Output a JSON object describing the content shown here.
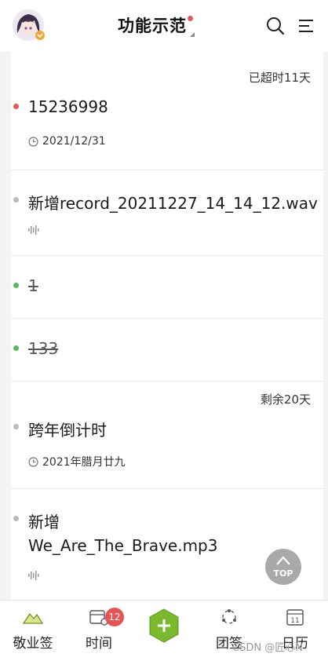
{
  "header": {
    "title": "功能示范"
  },
  "items": [
    {
      "status_note": "已超时11天",
      "title": "15236998",
      "date": "2021/12/31",
      "dot_color": "#e05a5a"
    },
    {
      "title": "新增record_20211227_14_14_12.wav",
      "dot_color": "#bbbbbb",
      "meta_icon": "audio-wave-icon"
    },
    {
      "title": "1",
      "dot_color": "#5cb85c",
      "completed": true
    },
    {
      "title": "133",
      "dot_color": "#5cb85c",
      "completed": true
    },
    {
      "status_note": "剩余20天",
      "title": "跨年倒计时",
      "date": "2021年腊月廿九",
      "dot_color": "#bbbbbb"
    },
    {
      "title_line1": "新增",
      "title_line2": "We_Are_The_Brave.mp3",
      "dot_color": "#bbbbbb",
      "meta_icon": "audio-wave-icon"
    }
  ],
  "top_button": {
    "label": "TOP"
  },
  "tabbar": {
    "tabs": [
      {
        "label": "敬业签",
        "icon": "mountain-icon"
      },
      {
        "label": "时间",
        "icon": "calendar-time-icon",
        "badge": "12"
      },
      {
        "label": "",
        "icon": "add-icon",
        "accent": "#7ab82e"
      },
      {
        "label": "团签",
        "icon": "group-icon"
      },
      {
        "label": "日历",
        "icon": "calendar-icon",
        "day": "11"
      }
    ]
  },
  "watermark": "CSDN @匠心N"
}
